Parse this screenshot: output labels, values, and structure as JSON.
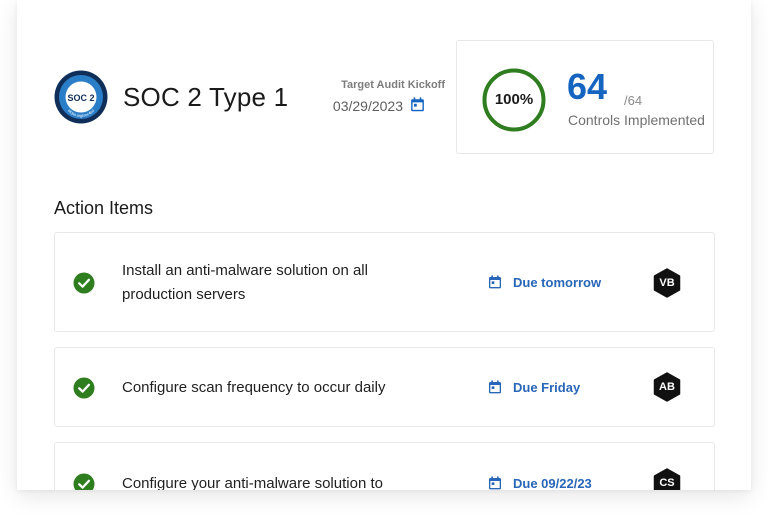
{
  "header": {
    "badge": {
      "top_text": "AICPA",
      "main_text": "SOC 2",
      "ring_text": "aicpa.org/soc4so",
      "colors": {
        "outer": "#0f2f59",
        "ring": "#2a7ec8",
        "inner": "#ffffff"
      }
    },
    "title": "SOC 2 Type 1",
    "target_audit": {
      "label": "Target Audit Kickoff",
      "date": "03/29/2023",
      "icon": "calendar-icon"
    },
    "controls": {
      "percent": "100%",
      "percent_value": 100,
      "implemented": "64",
      "total": "/64",
      "label": "Controls Implemented",
      "colors": {
        "ring": "#2e7d1e",
        "count": "#1565c0"
      }
    }
  },
  "action_items": {
    "title": "Action Items",
    "items": [
      {
        "text": "Install an anti-malware solution on all production servers",
        "due": "Due tomorrow",
        "assignee": "VB",
        "status_icon": "check-circle-icon"
      },
      {
        "text": "Configure scan frequency to occur daily",
        "due": "Due Friday",
        "assignee": "AB",
        "status_icon": "check-circle-icon"
      },
      {
        "text": "Configure your anti-malware solution to",
        "due": "Due 09/22/23",
        "assignee": "CS",
        "status_icon": "check-circle-icon"
      }
    ],
    "colors": {
      "check": "#2e7d1e",
      "due": "#2866b8",
      "avatar": "#111111"
    }
  }
}
